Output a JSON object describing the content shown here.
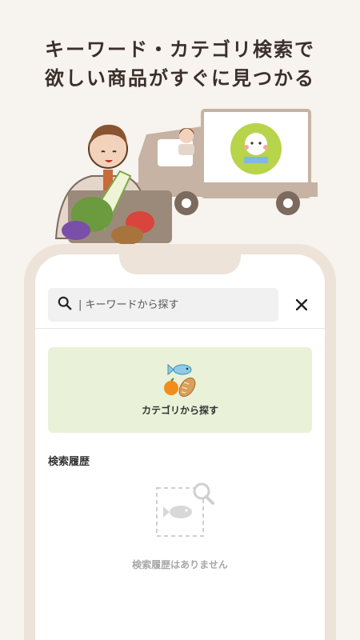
{
  "headline": {
    "line1": "キーワード・カテゴリ検索で",
    "line2": "欲しい商品がすぐに見つかる"
  },
  "illustration": {
    "icon": "delivery-truck-with-grocery-shopper"
  },
  "search": {
    "placeholder": "| キーワードから探す",
    "value": "",
    "icon": "search-icon",
    "close_icon": "close-icon"
  },
  "category": {
    "label": "カテゴリから探す",
    "icons": [
      "fish-icon",
      "orange-icon",
      "bread-icon"
    ]
  },
  "history": {
    "title": "検索履歴",
    "empty_message": "検索履歴はありません",
    "empty_icon": "fish-search-icon"
  },
  "colors": {
    "background": "#f7f3ee",
    "phone_frame": "#ede3d8",
    "category_card": "#e9f2d8",
    "search_bg": "#f1f1f1",
    "muted_text": "#a8a8a8"
  }
}
